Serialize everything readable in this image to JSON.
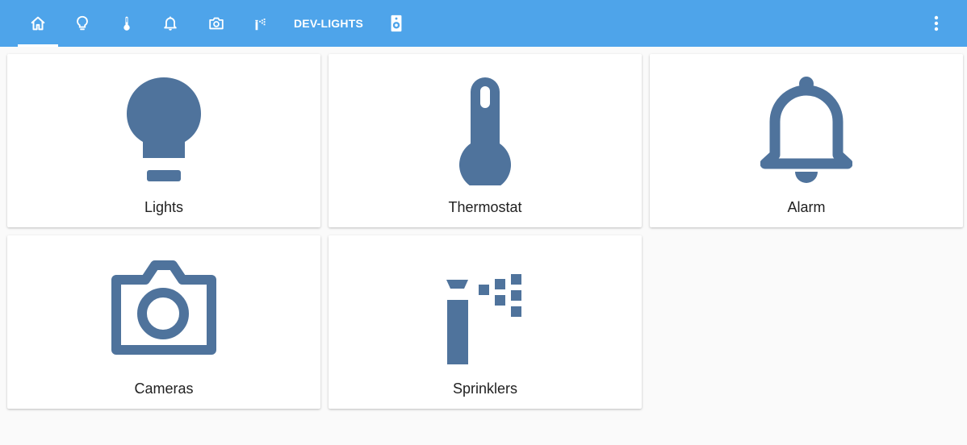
{
  "colors": {
    "header_bg": "#4ea4ea",
    "icon_color": "#4f739c",
    "page_bg": "#fafafa",
    "card_bg": "#ffffff"
  },
  "header": {
    "tabs": [
      {
        "icon": "home-icon",
        "active": true
      },
      {
        "icon": "lightbulb-icon"
      },
      {
        "icon": "thermometer-icon"
      },
      {
        "icon": "bell-icon"
      },
      {
        "icon": "camera-icon"
      },
      {
        "icon": "sprinkler-icon"
      },
      {
        "label": "DEV-LIGHTS"
      },
      {
        "icon": "speaker-icon"
      }
    ],
    "menu_icon": "dots-vertical-icon"
  },
  "cards": [
    {
      "label": "Lights",
      "icon": "lightbulb-icon"
    },
    {
      "label": "Thermostat",
      "icon": "thermometer-icon"
    },
    {
      "label": "Alarm",
      "icon": "bell-icon"
    },
    {
      "label": "Cameras",
      "icon": "camera-icon"
    },
    {
      "label": "Sprinklers",
      "icon": "sprinkler-icon"
    }
  ]
}
